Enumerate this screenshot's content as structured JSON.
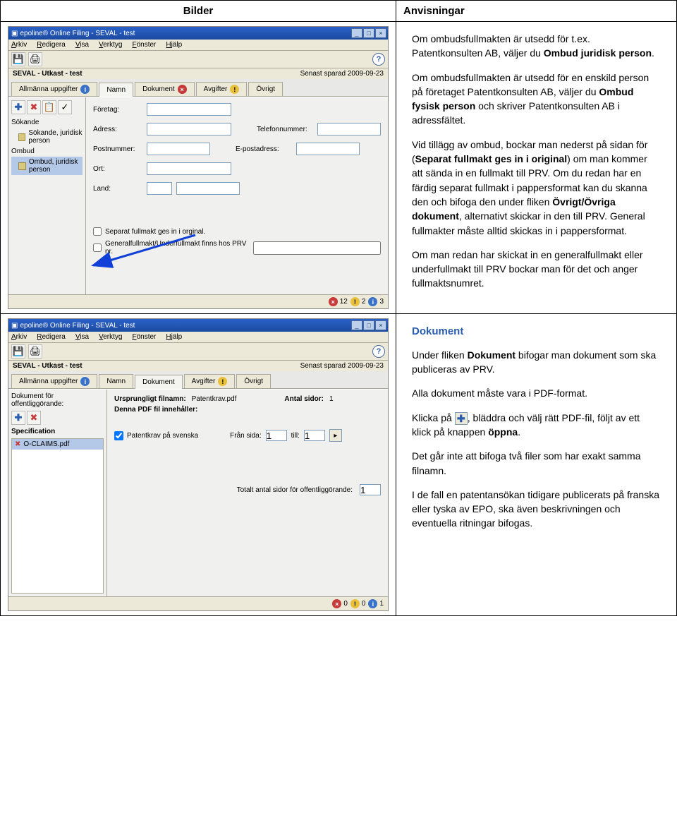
{
  "table_headers": {
    "left": "Bilder",
    "right": "Anvisningar"
  },
  "scr1": {
    "title": "epoline® Online Filing - SEVAL - test",
    "menu": [
      "Arkiv",
      "Redigera",
      "Visa",
      "Verktyg",
      "Fönster",
      "Hjälp"
    ],
    "subtitle": "SEVAL - Utkast - test",
    "saved": "Senast sparad 2009-09-23",
    "tabs": [
      {
        "label": "Allmänna uppgifter",
        "badge": "i",
        "color": "blue"
      },
      {
        "label": "Namn",
        "badge": "",
        "color": ""
      },
      {
        "label": "Dokument",
        "badge": "×",
        "color": "red"
      },
      {
        "label": "Avgifter",
        "badge": "!",
        "color": "yellow"
      },
      {
        "label": "Övrigt",
        "badge": "",
        "color": ""
      }
    ],
    "side": {
      "tbuttons": [
        "➕",
        "✖",
        "📋",
        "✓"
      ],
      "groups": [
        {
          "head": "Sökande",
          "items": [
            {
              "label": "Sökande, juridisk person"
            }
          ]
        },
        {
          "head": "Ombud",
          "items": [
            {
              "label": "Ombud, juridisk person",
              "sel": true
            }
          ]
        }
      ]
    },
    "form": {
      "rows": [
        {
          "l1": "Företag:",
          "w1": "w120"
        },
        {
          "l1": "Adress:",
          "w1": "w120",
          "l2": "Telefonnummer:",
          "w2": "w90"
        },
        {
          "l1": "Postnummer:",
          "w1": "w90",
          "l2": "E-postadress:",
          "w2": "w90"
        },
        {
          "l1": "Ort:",
          "w1": "w120"
        },
        {
          "l1": "Land:",
          "w1": "w36",
          "w1b": "w90"
        }
      ],
      "chk1": "Separat fullmakt ges in i orginal.",
      "chk2": "Generalfullmakt/Underfullmakt finns hos PRV nr."
    },
    "status": [
      {
        "badge": "×",
        "color": "red",
        "n": "12"
      },
      {
        "badge": "!",
        "color": "yellow",
        "n": "2"
      },
      {
        "badge": "i",
        "color": "blue",
        "n": "3"
      }
    ]
  },
  "instr1": {
    "p1a": "Om ombudsfullmakten är utsedd för t.ex. Patentkonsulten AB, väljer du ",
    "p1b": "Ombud juridisk person",
    "p1c": ".",
    "p2a": "Om ombudsfullmakten är utsedd för en enskild person på företaget Patentkonsulten AB, väljer du ",
    "p2b": "Ombud fysisk person",
    "p2c": " och skriver Patentkonsulten AB i adressfältet.",
    "p3a": "Vid tillägg av ombud, bockar man nederst på sidan för (",
    "p3b": "Separat fullmakt ges in i original",
    "p3c": ") om man kommer att sända in en fullmakt till PRV. Om du redan har en färdig separat fullmakt i pappersformat kan du skanna den och bifoga den under fliken ",
    "p3d": "Övrigt/Övriga dokument",
    "p3e": ", alternativt skickar in den till PRV. General fullmakter måste alltid skickas in i pappersformat.",
    "p4": "Om man redan har skickat in en generalfullmakt eller underfullmakt till PRV bockar man för det och anger fullmaktsnumret."
  },
  "scr2": {
    "title": "epoline® Online Filing - SEVAL - test",
    "menu": [
      "Arkiv",
      "Redigera",
      "Visa",
      "Verktyg",
      "Fönster",
      "Hjälp"
    ],
    "subtitle": "SEVAL - Utkast - test",
    "saved": "Senast sparad 2009-09-23",
    "tabs": [
      {
        "label": "Allmänna uppgifter",
        "badge": "i",
        "color": "blue"
      },
      {
        "label": "Namn",
        "badge": "",
        "color": ""
      },
      {
        "label": "Dokument",
        "badge": "",
        "color": ""
      },
      {
        "label": "Avgifter",
        "badge": "!",
        "color": "yellow"
      },
      {
        "label": "Övrigt",
        "badge": "",
        "color": ""
      }
    ],
    "side": {
      "head": "Dokument för offentliggörande:",
      "tbuttons": [
        "➕",
        "✖"
      ],
      "group_head": "Specification",
      "item": "O-CLAIMS.pdf"
    },
    "doc": {
      "l_orig": "Ursprungligt filnamn:",
      "v_orig": "Patentkrav.pdf",
      "l_pages": "Antal sidor:",
      "v_pages": "1",
      "sub": "Denna PDF fil innehåller:",
      "chk": "Patentkrav på svenska",
      "from": "Från sida:",
      "from_v": "1",
      "to": "till:",
      "to_v": "1",
      "total": "Totalt antal sidor för offentliggörande:",
      "total_v": "1"
    },
    "status": [
      {
        "badge": "×",
        "color": "red",
        "n": "0"
      },
      {
        "badge": "!",
        "color": "yellow",
        "n": "0"
      },
      {
        "badge": "i",
        "color": "blue",
        "n": "1"
      }
    ]
  },
  "instr2": {
    "head": "Dokument",
    "p1a": "Under fliken ",
    "p1b": "Dokument",
    "p1c": " bifogar man dokument som ska publiceras av PRV.",
    "p2": "Alla dokument måste vara i PDF-format.",
    "p3a": "Klicka på ",
    "p3b": ", bläddra och välj rätt PDF-fil, följt av ett klick på knappen ",
    "p3c": "öppna",
    "p3d": ".",
    "p4": "Det går inte att bifoga två filer som har exakt samma filnamn.",
    "p5": "I de fall en patentansökan tidigare publicerats på franska eller tyska av EPO, ska även beskrivningen och eventuella ritningar bifogas."
  }
}
